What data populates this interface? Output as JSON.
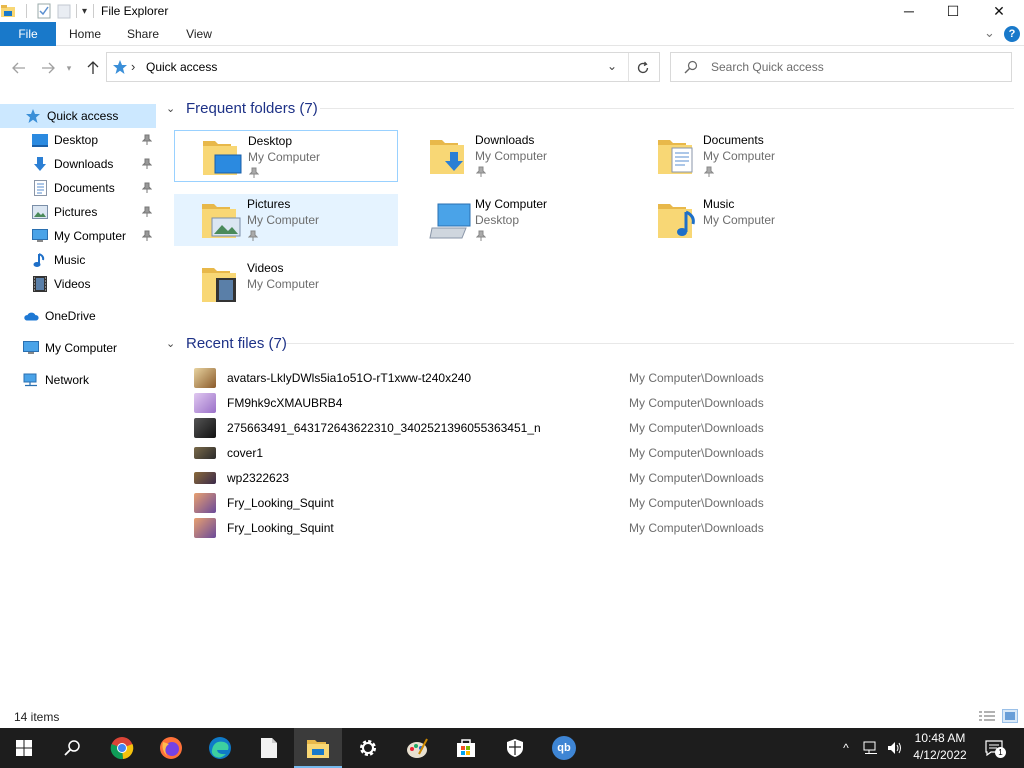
{
  "window": {
    "title": "File Explorer",
    "minimize_glyph": "─",
    "maximize_glyph": "☐",
    "close_glyph": "✕"
  },
  "ribbon": {
    "tabs": [
      "File",
      "Home",
      "Share",
      "View"
    ],
    "expand_glyph": "⌄",
    "help_glyph": "?"
  },
  "address": {
    "path_sep": "›",
    "location": "Quick access",
    "search_placeholder": "Search Quick access"
  },
  "navpane": {
    "items": [
      {
        "label": "Quick access",
        "icon": "star-icon",
        "selected": true
      },
      {
        "label": "Desktop",
        "icon": "desktop-icon",
        "pinned": true
      },
      {
        "label": "Downloads",
        "icon": "download-icon",
        "pinned": true
      },
      {
        "label": "Documents",
        "icon": "documents-icon",
        "pinned": true
      },
      {
        "label": "Pictures",
        "icon": "pictures-icon",
        "pinned": true
      },
      {
        "label": "My Computer",
        "icon": "computer-icon",
        "pinned": true
      },
      {
        "label": "Music",
        "icon": "music-icon"
      },
      {
        "label": "Videos",
        "icon": "videos-icon"
      },
      {
        "label": "OneDrive",
        "icon": "cloud-icon"
      },
      {
        "label": "My Computer",
        "icon": "computer-icon"
      },
      {
        "label": "Network",
        "icon": "network-icon"
      }
    ]
  },
  "frequent": {
    "header": "Frequent folders (7)",
    "folders": [
      {
        "name": "Desktop",
        "sub": "My Computer",
        "pinned": true,
        "icon": "desktop-folder-icon"
      },
      {
        "name": "Downloads",
        "sub": "My Computer",
        "pinned": true,
        "icon": "downloads-folder-icon"
      },
      {
        "name": "Documents",
        "sub": "My Computer",
        "pinned": true,
        "icon": "documents-folder-icon"
      },
      {
        "name": "Pictures",
        "sub": "My Computer",
        "pinned": true,
        "icon": "pictures-folder-icon"
      },
      {
        "name": "My Computer",
        "sub": "Desktop",
        "pinned": true,
        "icon": "computer-icon"
      },
      {
        "name": "Music",
        "sub": "My Computer",
        "pinned": false,
        "icon": "music-folder-icon"
      },
      {
        "name": "Videos",
        "sub": "My Computer",
        "pinned": false,
        "icon": "videos-folder-icon"
      }
    ]
  },
  "recent": {
    "header": "Recent files (7)",
    "files": [
      {
        "name": "avatars-LklyDWls5ia1o51O-rT1xww-t240x240",
        "location": "My Computer\\Downloads",
        "thumb": "#c89a55"
      },
      {
        "name": "FM9hk9cXMAUBRB4",
        "location": "My Computer\\Downloads",
        "thumb": "#b48fd8"
      },
      {
        "name": "275663491_643172643622310_3402521396055363451_n",
        "location": "My Computer\\Downloads",
        "thumb": "#3a3a3a"
      },
      {
        "name": "cover1",
        "location": "My Computer\\Downloads",
        "thumb": "#5a4a3a"
      },
      {
        "name": "wp2322623",
        "location": "My Computer\\Downloads",
        "thumb": "#6a5a4a"
      },
      {
        "name": "Fry_Looking_Squint",
        "location": "My Computer\\Downloads",
        "thumb": "#d98a5a"
      },
      {
        "name": "Fry_Looking_Squint",
        "location": "My Computer\\Downloads",
        "thumb": "#d98a5a"
      }
    ]
  },
  "status": {
    "items_count": "14 items"
  },
  "taskbar": {
    "apps": [
      "windows-start-icon",
      "search-icon",
      "chrome-icon",
      "firefox-icon",
      "edge-icon",
      "notepad-icon",
      "file-explorer-icon",
      "settings-icon",
      "paint-icon",
      "store-icon",
      "security-icon",
      "qbittorrent-icon"
    ],
    "active_app": "file-explorer-icon",
    "qbittorrent_label": "qb",
    "tray_chevron": "^",
    "time": "10:48 AM",
    "date": "4/12/2022",
    "notification_count": "1"
  },
  "colors": {
    "accent": "#1979ca",
    "section_header": "#1e3287",
    "selected_bg": "#cce8ff",
    "hover_bg": "#e5f3ff",
    "folder_yellow": "#f8d775",
    "taskbar_bg": "#1d1d1d"
  }
}
